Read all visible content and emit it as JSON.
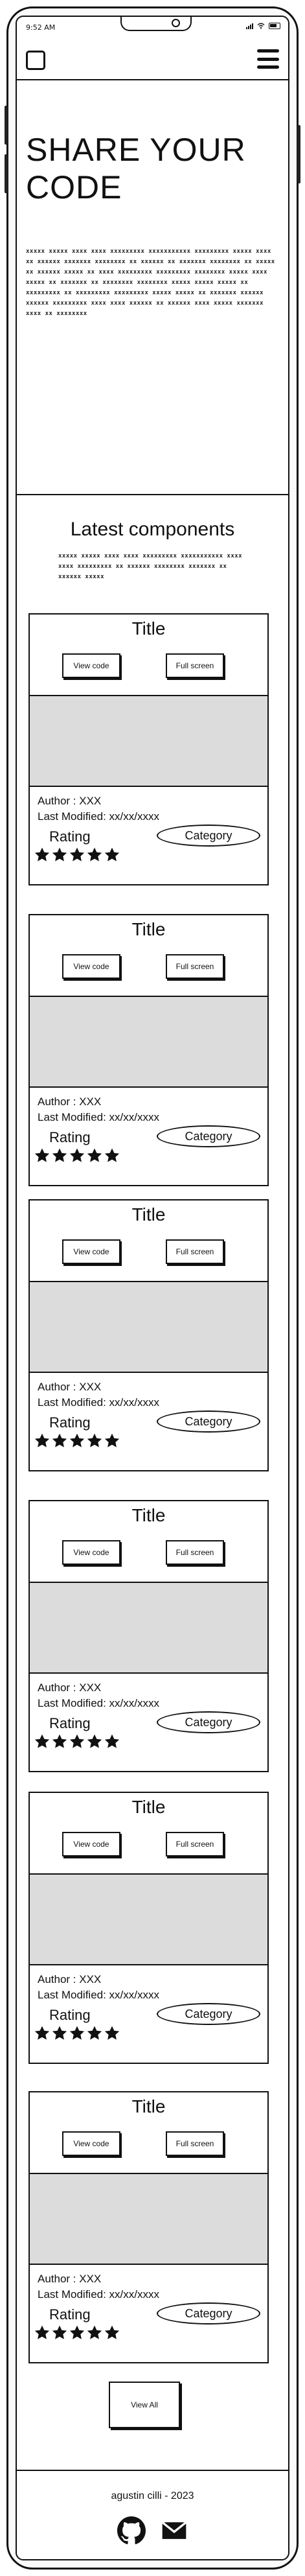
{
  "statusbar": {
    "time": "9:52 AM"
  },
  "hero": {
    "title_line1": "SHARE YOUR",
    "title_line2": "CODE",
    "scribble": "xxxxx xxxxx xxxx xxxx xxxxxxxxx xxxxxxxxxxx xxxxxxxxx xxxxx xxxx xx xxxxxx xxxxxxx xxxxxxxx xx xxxxxx xx xxxxxxx xxxxxxxx xx xxxxx xx xxxxxx xxxxx xx xxxx xxxxxxxxx xxxxxxxxx xxxxxxxx xxxxx xxxx xxxxx xx xxxxxxx xx xxxxxxxx xxxxxxxx xxxxx xxxxx xxxxx xx xxxxxxxxx xx xxxxxxxxx xxxxxxxxx xxxxx xxxxx xx xxxxxxx xxxxxx xxxxxx xxxxxxxxx xxxx xxxx xxxxxx xx xxxxxx xxxx xxxxx xxxxxxx xxxx xx xxxxxxxx"
  },
  "latest": {
    "title": "Latest components",
    "scribble": "xxxxx xxxxx xxxx xxxx xxxxxxxxx xxxxxxxxxxx xxxx xxxx xxxxxxxxx xx xxxxxx xxxxxxxx xxxxxxx xx xxxxxx xxxxx"
  },
  "cards": [
    {
      "title": "Title",
      "view_code": "View code",
      "full_screen": "Full screen",
      "author": "Author : XXX",
      "modified": "Last Modified: xx/xx/xxxx",
      "rating_label": "Rating",
      "stars": 5,
      "category": "Category"
    },
    {
      "title": "Title",
      "view_code": "View code",
      "full_screen": "Full screen",
      "author": "Author : XXX",
      "modified": "Last Modified: xx/xx/xxxx",
      "rating_label": "Rating",
      "stars": 5,
      "category": "Category"
    },
    {
      "title": "Title",
      "view_code": "View code",
      "full_screen": "Full screen",
      "author": "Author : XXX",
      "modified": "Last Modified: xx/xx/xxxx",
      "rating_label": "Rating",
      "stars": 5,
      "category": "Category"
    },
    {
      "title": "Title",
      "view_code": "View code",
      "full_screen": "Full screen",
      "author": "Author : XXX",
      "modified": "Last Modified: xx/xx/xxxx",
      "rating_label": "Rating",
      "stars": 5,
      "category": "Category"
    },
    {
      "title": "Title",
      "view_code": "View code",
      "full_screen": "Full screen",
      "author": "Author : XXX",
      "modified": "Last Modified: xx/xx/xxxx",
      "rating_label": "Rating",
      "stars": 5,
      "category": "Category"
    },
    {
      "title": "Title",
      "view_code": "View code",
      "full_screen": "Full screen",
      "author": "Author : XXX",
      "modified": "Last Modified: xx/xx/xxxx",
      "rating_label": "Rating",
      "stars": 5,
      "category": "Category"
    }
  ],
  "view_all": "View All",
  "footer": {
    "credit": "agustin cilli - 2023",
    "icons": [
      "github-icon",
      "mail-icon"
    ]
  }
}
